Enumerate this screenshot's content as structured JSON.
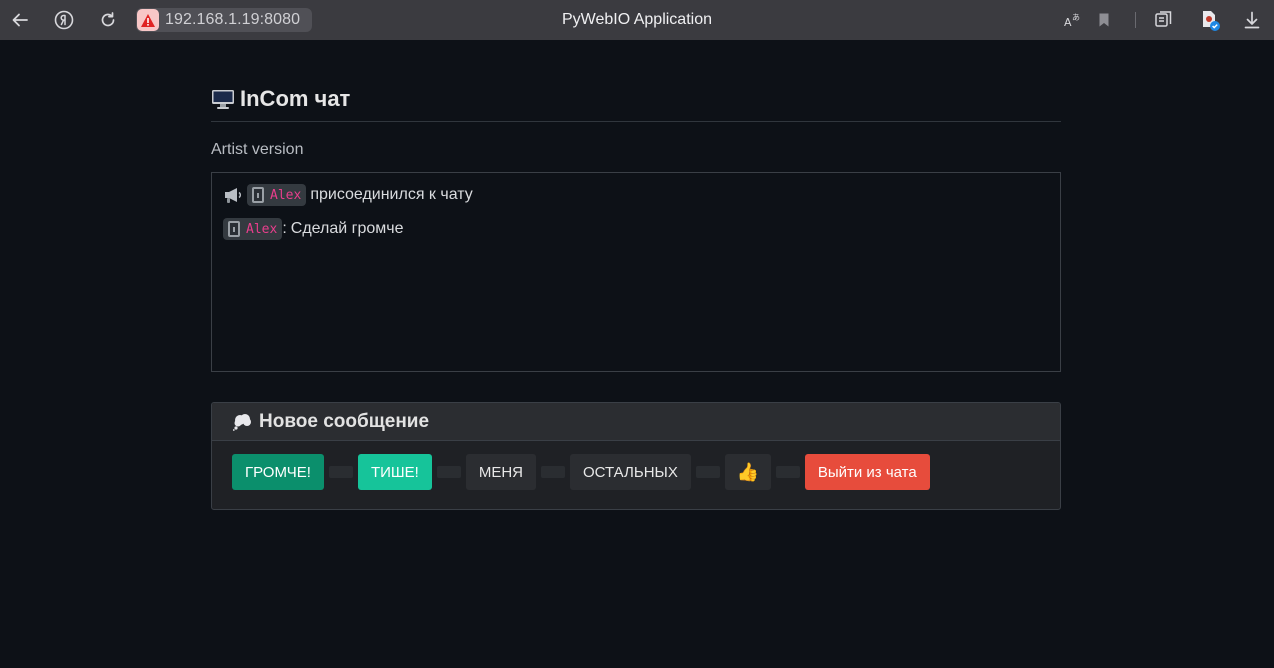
{
  "browser": {
    "url": "192.168.1.19:8080",
    "window_title": "PyWebIO Application"
  },
  "page": {
    "title": "InCom чат",
    "subtitle": "Artist version"
  },
  "chat": {
    "messages": [
      {
        "user": "Alex",
        "text": "присоединился к чату",
        "separator": ""
      },
      {
        "user": "Alex",
        "text": "Сделай громче",
        "separator": ":"
      }
    ]
  },
  "compose": {
    "header": "Новое сообщение",
    "buttons": [
      {
        "label": "ГРОМЧЕ!",
        "color": "#0b8f6c"
      },
      {
        "label": "ТИШЕ!",
        "color": "#16c49a"
      },
      {
        "label": "МЕНЯ",
        "color": "#2b2d31"
      },
      {
        "label": "ОСТАЛЬНЫХ",
        "color": "#2b2d31"
      },
      {
        "label": "👍",
        "color": "#2b2d31"
      },
      {
        "label": "Выйти из чата",
        "color": "#e74c3c"
      }
    ]
  },
  "icons": {
    "back": "arrow-left-icon",
    "yandex": "yandex-icon",
    "reload": "reload-icon",
    "insecure": "warning-icon",
    "translate": "translate-icon",
    "bookmark": "bookmark-icon",
    "tabs": "collections-icon",
    "extension": "extension-icon",
    "download": "download-icon",
    "title": "desktop-computer-icon",
    "join": "megaphone-icon",
    "user": "mobile-phone-icon",
    "compose": "thought-bubble-icon"
  }
}
